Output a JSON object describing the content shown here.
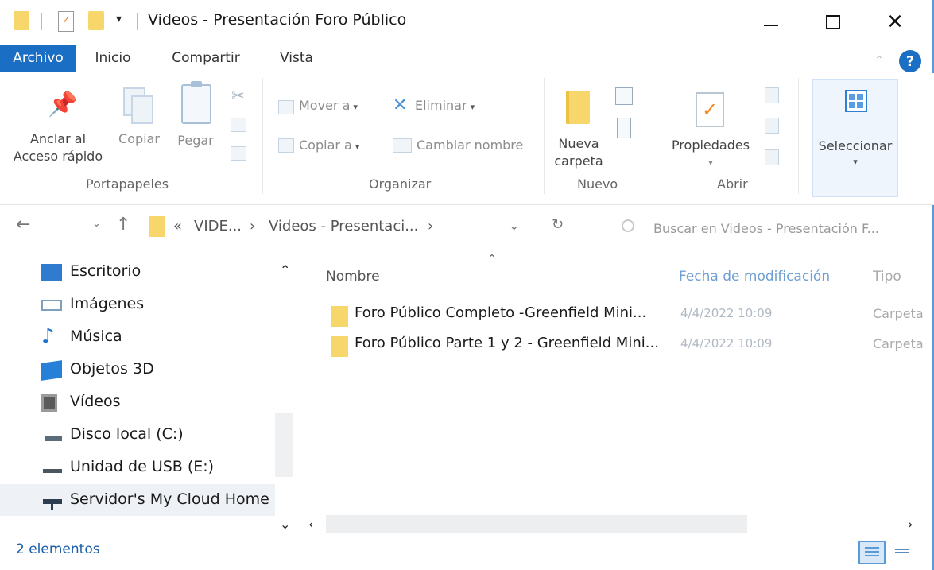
{
  "window": {
    "title": "Videos - Presentación Foro Público"
  },
  "tabs": [
    {
      "label": "Archivo",
      "active": true
    },
    {
      "label": "Inicio",
      "active": false
    },
    {
      "label": "Compartir",
      "active": false
    },
    {
      "label": "Vista",
      "active": false
    }
  ],
  "ribbon": {
    "portapapeles": {
      "group_label": "Portapapeles",
      "pin_label_1": "Anclar al",
      "pin_label_2": "Acceso rápido",
      "copy_label": "Copiar",
      "paste_label": "Pegar"
    },
    "organizar": {
      "group_label": "Organizar",
      "move_label": "Mover a",
      "copy_to_label": "Copiar a",
      "delete_label": "Eliminar",
      "rename_label": "Cambiar nombre"
    },
    "nuevo": {
      "group_label": "Nuevo",
      "new_folder_1": "Nueva",
      "new_folder_2": "carpeta"
    },
    "abrir": {
      "group_label": "Abrir",
      "properties_label": "Propiedades"
    },
    "seleccionar": {
      "label": "Seleccionar"
    }
  },
  "address": {
    "crumb_prefix": "«",
    "crumb_1": "VIDE...",
    "crumb_sep": "›",
    "crumb_2": "Videos - Presentaci...",
    "search_placeholder": "Buscar en Videos - Presentación F..."
  },
  "nav_pane": [
    {
      "label": "Escritorio",
      "icon": "desktop-icon"
    },
    {
      "label": "Imágenes",
      "icon": "images-icon"
    },
    {
      "label": "Música",
      "icon": "music-icon"
    },
    {
      "label": "Objetos 3D",
      "icon": "objects-3d-icon"
    },
    {
      "label": "Vídeos",
      "icon": "videos-icon"
    },
    {
      "label": "Disco local (C:)",
      "icon": "local-disk-icon"
    },
    {
      "label": "Unidad de USB (E:)",
      "icon": "usb-drive-icon"
    },
    {
      "label": "Servidor's My Cloud Home (Z",
      "icon": "network-drive-icon"
    }
  ],
  "file_list": {
    "columns": {
      "name": "Nombre",
      "modified": "Fecha de modificación",
      "type": "Tipo"
    },
    "rows": [
      {
        "name": "Foro Público Completo -Greenfield Mini...",
        "modified": "4/4/2022 10:09",
        "type": "Carpeta"
      },
      {
        "name": "Foro Público Parte 1 y 2 - Greenfield Mini...",
        "modified": "4/4/2022 10:09",
        "type": "Carpeta"
      }
    ]
  },
  "status": {
    "item_count": "2 elementos"
  },
  "colors": {
    "accent": "#1a6fc4",
    "folder": "#f7d66b"
  }
}
